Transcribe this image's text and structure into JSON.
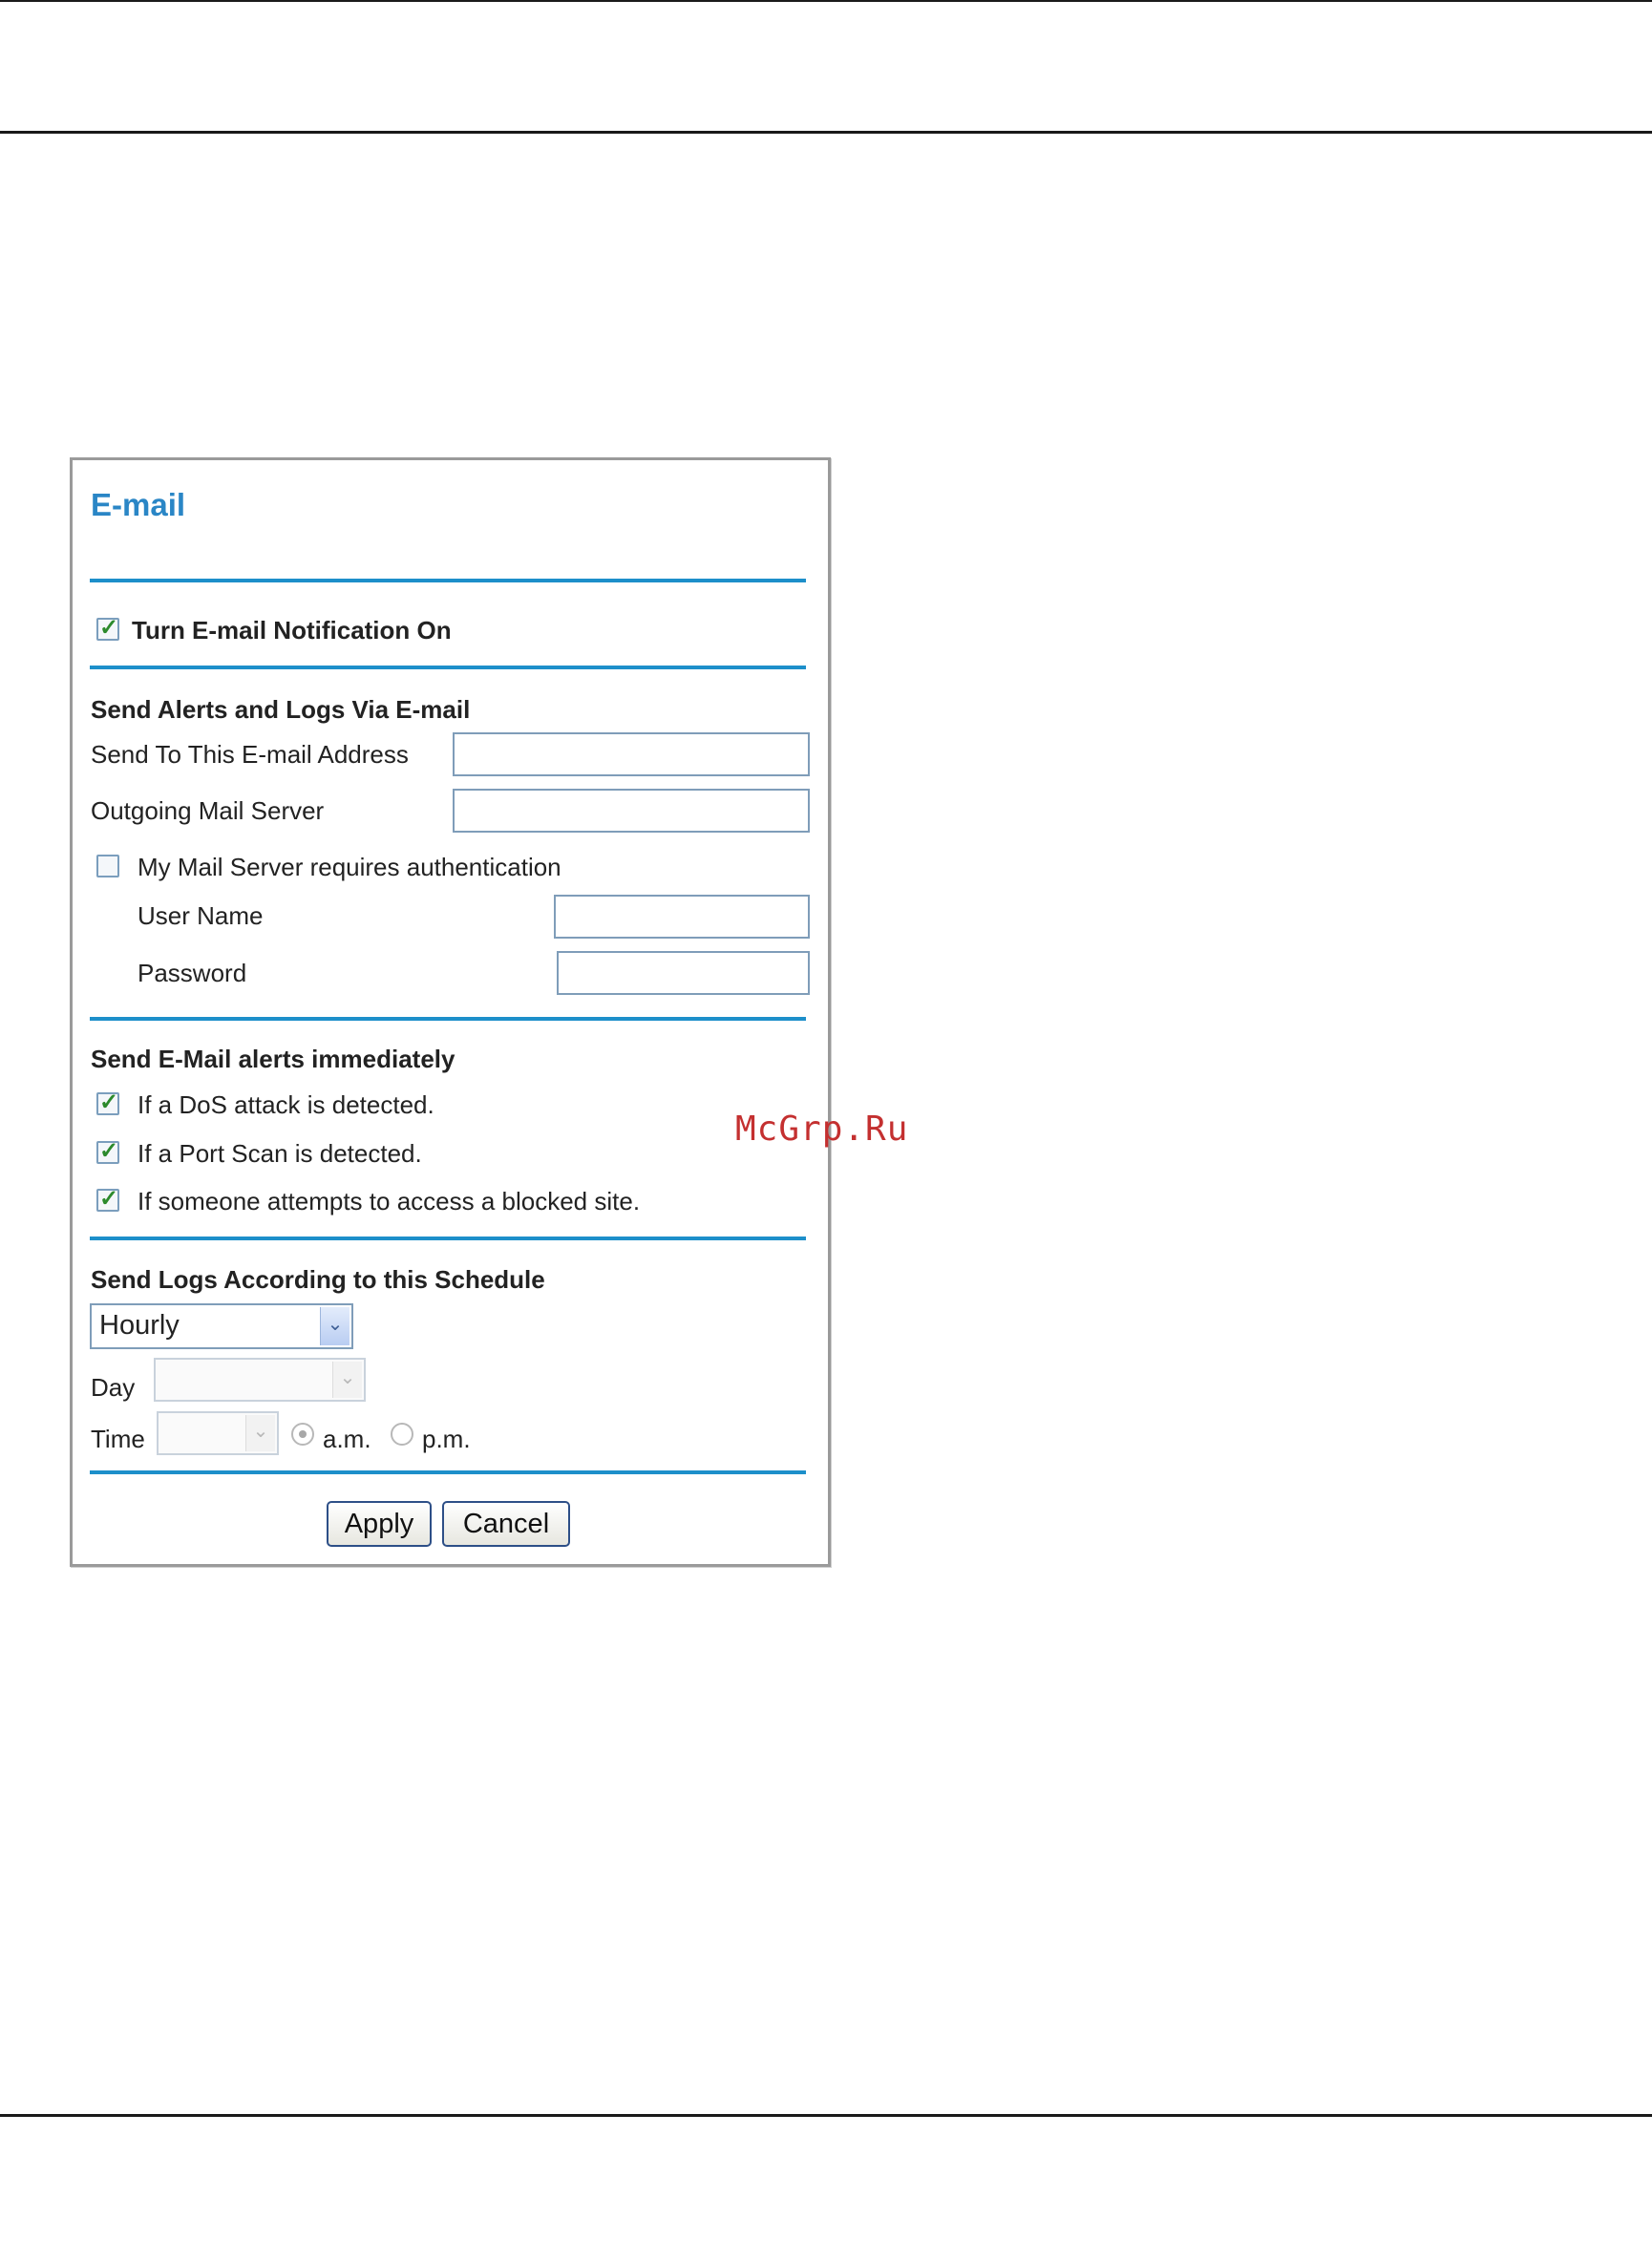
{
  "title": "E-mail",
  "notification": {
    "label": "Turn E-mail Notification On",
    "checked": true
  },
  "send_via": {
    "heading": "Send Alerts and Logs Via E-mail",
    "address_label": "Send To This E-mail Address",
    "address_value": "",
    "server_label": "Outgoing Mail Server",
    "server_value": "",
    "auth": {
      "label": "My Mail Server requires authentication",
      "checked": false
    },
    "username_label": "User Name",
    "username_value": "",
    "password_label": "Password",
    "password_value": ""
  },
  "alerts": {
    "heading": "Send E-Mail alerts immediately",
    "items": [
      {
        "label": "If a DoS attack is detected.",
        "checked": true
      },
      {
        "label": "If a Port Scan is detected.",
        "checked": true
      },
      {
        "label": "If someone attempts to access a blocked site.",
        "checked": true
      }
    ]
  },
  "schedule": {
    "heading": "Send Logs According to this Schedule",
    "frequency": "Hourly",
    "day_label": "Day",
    "day_value": "",
    "time_label": "Time",
    "time_value": "",
    "am_label": "a.m.",
    "pm_label": "p.m.",
    "selected_period": "a.m."
  },
  "buttons": {
    "apply": "Apply",
    "cancel": "Cancel"
  },
  "watermark": "McGrp.Ru",
  "colors": {
    "accent": "#1d8fca",
    "title": "#2a86c6",
    "check": "#2c8a2c",
    "watermark": "#c43030"
  }
}
